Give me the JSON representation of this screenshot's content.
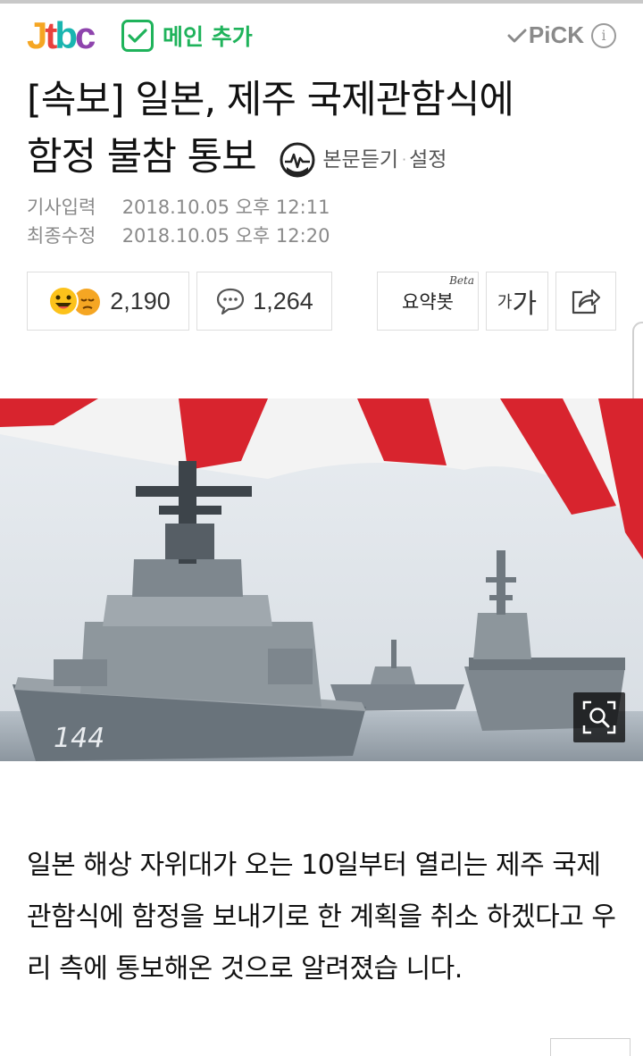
{
  "header": {
    "logo_letters": [
      "J",
      "t",
      "b",
      "c"
    ],
    "add_main_label": "메인 추가",
    "pick_label": "PiCK",
    "info_glyph": "i"
  },
  "article": {
    "title_line1": "[속보] 일본, 제주 국제관함식에",
    "title_line2": "함정 불참 통보",
    "listen_label": "본문듣기",
    "settings_label": "설정",
    "input_label": "기사입력",
    "input_date": "2018.10.05 오후 12:11",
    "modified_label": "최종수정",
    "modified_date": "2018.10.05 오후 12:20",
    "body": "일본 해상 자위대가 오는 10일부터 열리는 제주 국제관함식에 함정을 보내기로 한 계획을 취소 하겠다고 우리 측에 통보해온 것으로 알려졌습 니다."
  },
  "toolbar": {
    "reaction_count": "2,190",
    "comment_count": "1,264",
    "summary_label": "요약봇",
    "summary_badge": "Beta",
    "font_small": "가",
    "font_big": "가"
  },
  "photo": {
    "hull_number": "144"
  },
  "icons": {
    "check": "check-icon",
    "info": "info-icon",
    "listen": "audio-listen-icon",
    "emoji": "reaction-emoji-icon",
    "comment": "comment-bubble-icon",
    "share": "share-icon",
    "zoom": "zoom-magnifier-icon"
  },
  "colors": {
    "brand_green": "#1fb35b",
    "jtbc_orange": "#f5a623",
    "jtbc_red": "#e8413c",
    "jtbc_teal": "#19b5b0",
    "jtbc_purple": "#8e44ad"
  }
}
